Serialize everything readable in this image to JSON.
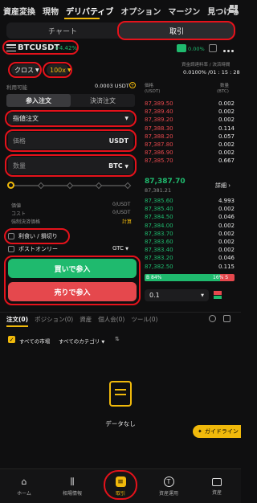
{
  "nav": {
    "items": [
      "資産変換",
      "現物",
      "デリバティブ",
      "オプション",
      "マージン",
      "見つける"
    ],
    "more_icon": "grid-icon"
  },
  "tabs": {
    "chart": "チャート",
    "trade": "取引"
  },
  "symbol": {
    "name": "BTCUSDT",
    "change": "+4.42%",
    "rate_label": "0.00%"
  },
  "mode": {
    "margin": "クロス",
    "leverage": "100x"
  },
  "funding": {
    "label": "資金調達料率 / 決済時間",
    "value": "0.0100% /01 : 15 : 28"
  },
  "available": {
    "label": "利用可能",
    "value": "0.0003 USDT"
  },
  "order_tabs": {
    "open": "参入注文",
    "close": "決済注文"
  },
  "order_type": "指値注文",
  "price_field": {
    "placeholder": "価格",
    "unit": "USDT"
  },
  "qty_field": {
    "placeholder": "数量",
    "unit": "BTC"
  },
  "info": {
    "value_label": "価値",
    "value": "0/USDT",
    "cost_label": "コスト",
    "cost": "0/USDT",
    "liq_label": "強制決済価格",
    "liq": "計算"
  },
  "options": {
    "tpsl": "利食い / 損切り",
    "postonly": "ポストオンリー",
    "tif": "GTC"
  },
  "buttons": {
    "buy": "買いで参入",
    "sell": "売りで参入"
  },
  "orderbook": {
    "price_header": "価格\n(USDT)",
    "qty_header": "数量\n(BTC)",
    "asks": [
      {
        "price": "87,389.50",
        "qty": "0.002"
      },
      {
        "price": "87,389.40",
        "qty": "0.002"
      },
      {
        "price": "87,389.20",
        "qty": "0.002"
      },
      {
        "price": "87,388.30",
        "qty": "0.114"
      },
      {
        "price": "87,388.20",
        "qty": "0.057"
      },
      {
        "price": "87,387.80",
        "qty": "0.002"
      },
      {
        "price": "87,386.90",
        "qty": "0.002"
      },
      {
        "price": "87,385.70",
        "qty": "0.667"
      }
    ],
    "last": "87,387.70",
    "mark": "87,381.21",
    "detail": "詳細",
    "bids": [
      {
        "price": "87,385.60",
        "qty": "4.993"
      },
      {
        "price": "87,385.40",
        "qty": "0.002"
      },
      {
        "price": "87,384.50",
        "qty": "0.046"
      },
      {
        "price": "87,384.00",
        "qty": "0.002"
      },
      {
        "price": "87,383.70",
        "qty": "0.002"
      },
      {
        "price": "87,383.60",
        "qty": "0.002"
      },
      {
        "price": "87,383.40",
        "qty": "0.002"
      },
      {
        "price": "87,383.20",
        "qty": "0.046"
      },
      {
        "price": "87,382.50",
        "qty": "0.115"
      }
    ],
    "buy_ratio": "84%",
    "sell_ratio": "16%",
    "tick": "0.1"
  },
  "bottom_tabs": [
    "注文(0)",
    "ポジション(0)",
    "資産",
    "個人会(0)",
    "ツール(0)"
  ],
  "filter": {
    "all_markets": "すべての市場",
    "all_categories": "すべてのカテゴリ"
  },
  "empty": "データなし",
  "guide": "ガイドライン",
  "bottom_nav": [
    "ホーム",
    "相場情報",
    "取引",
    "資産運用",
    "資産"
  ],
  "colors": {
    "buy": "#1fba6e",
    "sell": "#e5484d",
    "accent": "#f0b90b",
    "highlight": "#e5121b"
  }
}
